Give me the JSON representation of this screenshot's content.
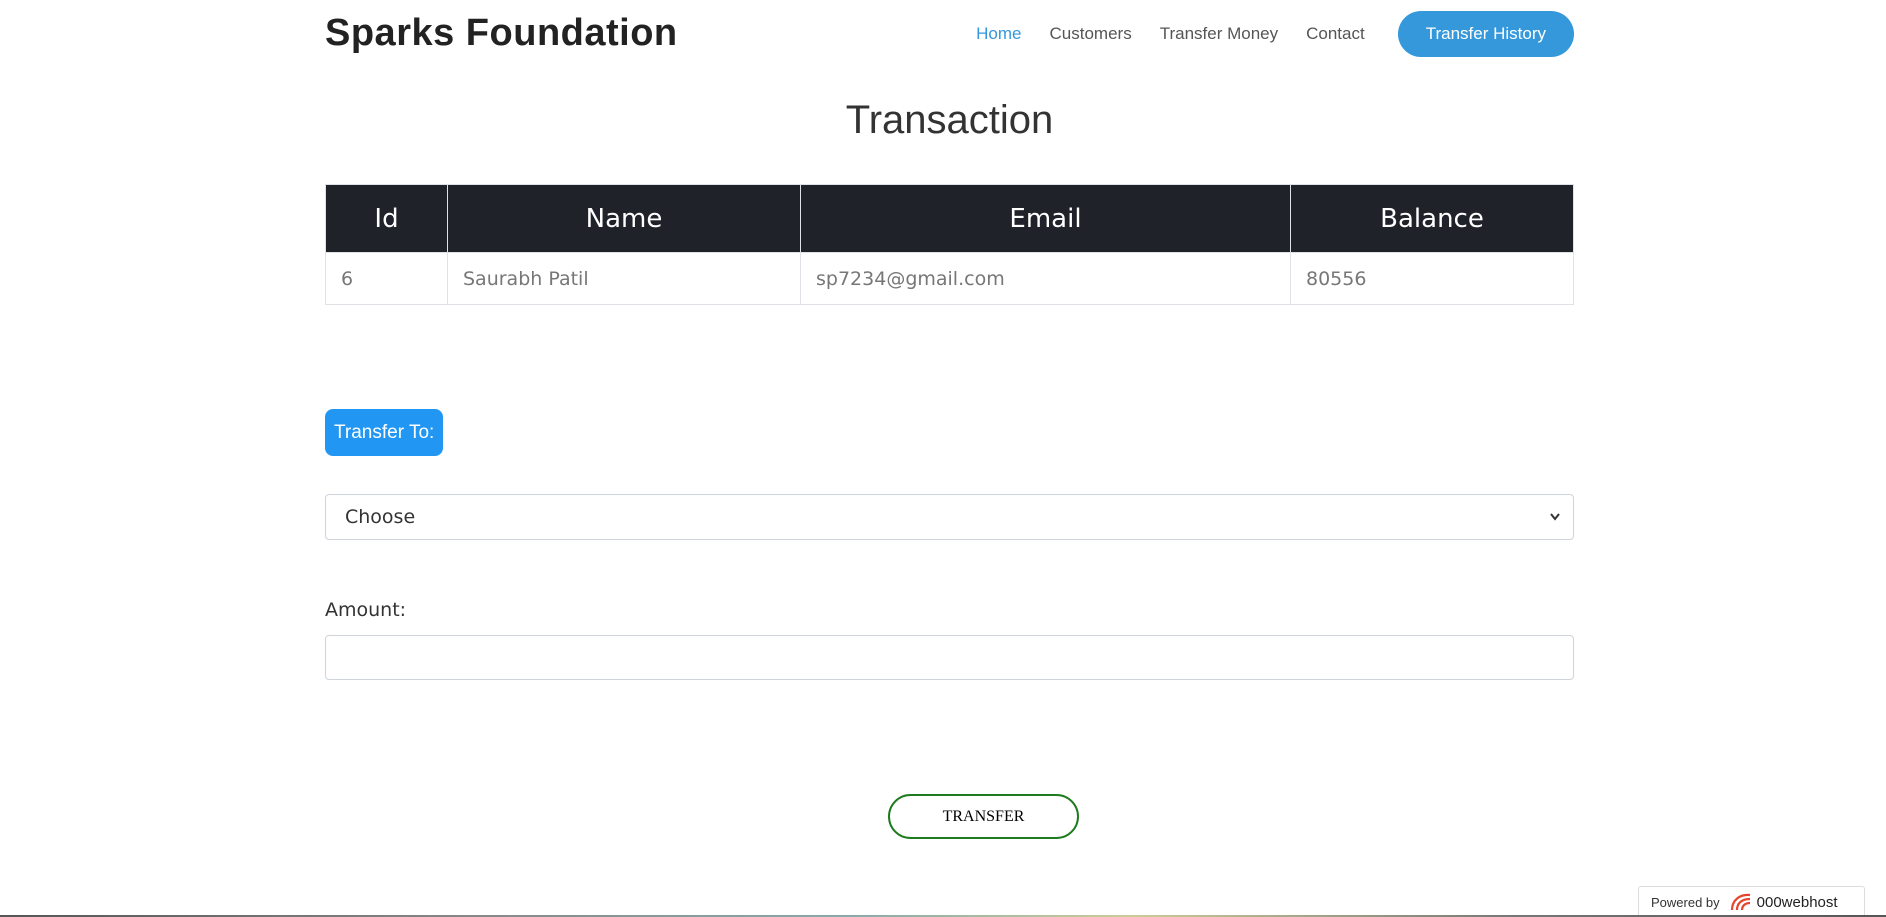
{
  "header": {
    "brand": "Sparks Foundation",
    "nav": [
      "Home",
      "Customers",
      "Transfer Money",
      "Contact"
    ],
    "active_nav": "Home",
    "history_button": "Transfer History"
  },
  "page_title": "Transaction",
  "table": {
    "columns": [
      "Id",
      "Name",
      "Email",
      "Balance"
    ],
    "row": {
      "id": "6",
      "name": "Saurabh Patil",
      "email": "sp7234@gmail.com",
      "balance": "80556"
    }
  },
  "form": {
    "transfer_to_label": "Transfer To:",
    "select_value": "Choose",
    "amount_label": "Amount:",
    "amount_value": "",
    "submit_label": "TRANSFER"
  },
  "footer": {
    "powered_by": "Powered by",
    "host_name": "000webhost"
  },
  "colors": {
    "accent": "#3498db",
    "table_header": "#1f2229",
    "button_border": "#1e7b1e"
  }
}
